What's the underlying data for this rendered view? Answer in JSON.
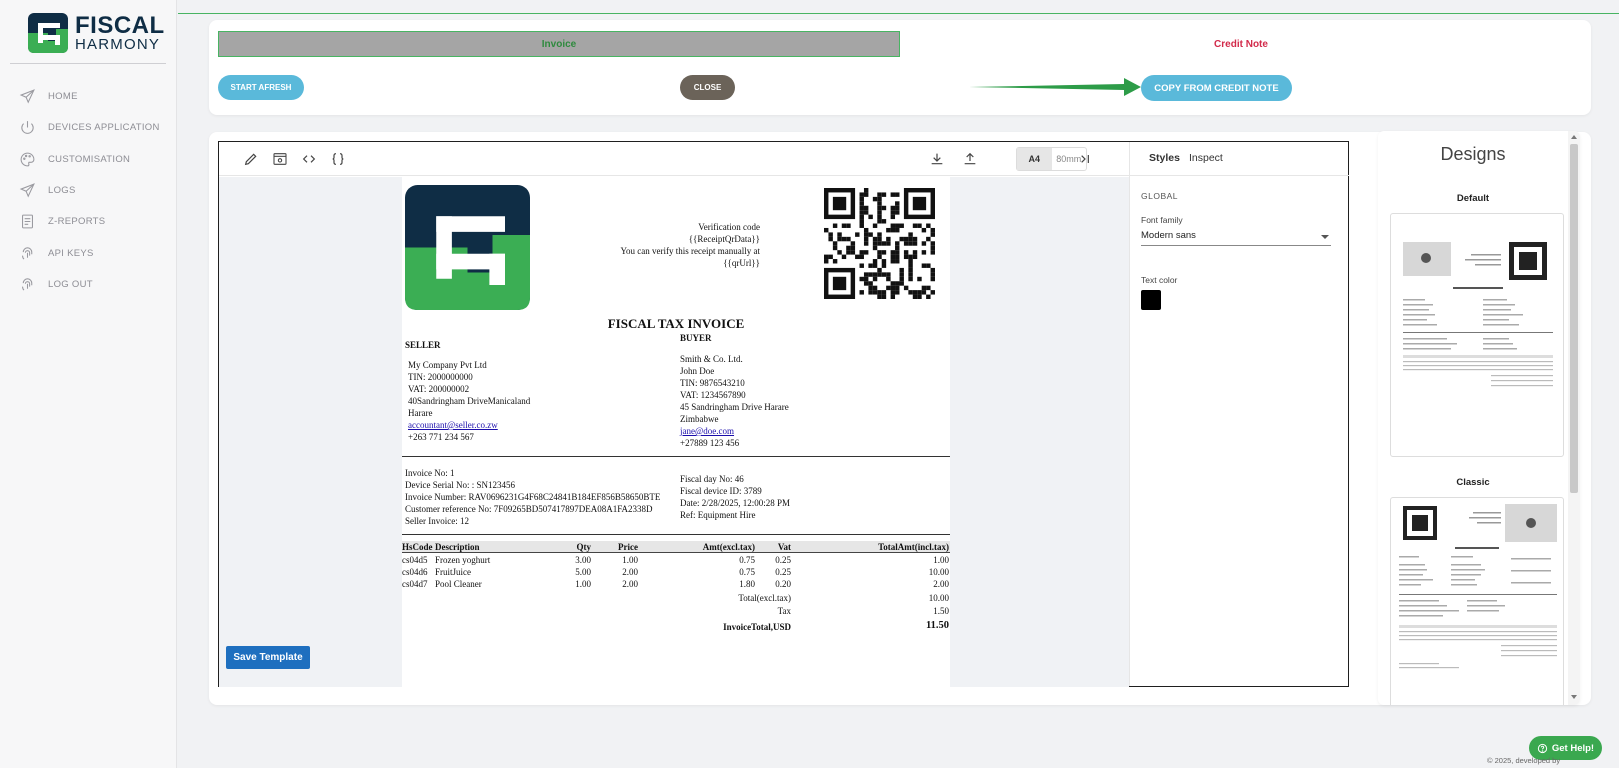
{
  "brand": {
    "line1": "FISCAL",
    "line2": "HARMONY",
    "dark": "#0f2d45",
    "green": "#3bae54"
  },
  "nav": [
    {
      "label": "HOME",
      "icon": "send-icon"
    },
    {
      "label": "DEVICES APPLICATION",
      "icon": "power-icon"
    },
    {
      "label": "CUSTOMISATION",
      "icon": "palette-icon"
    },
    {
      "label": "LOGS",
      "icon": "send-icon"
    },
    {
      "label": "Z-REPORTS",
      "icon": "document-icon"
    },
    {
      "label": "API KEYS",
      "icon": "fingerprint-icon"
    },
    {
      "label": "LOG OUT",
      "icon": "fingerprint-icon"
    }
  ],
  "tabs": {
    "invoice": "Invoice",
    "credit_note": "Credit Note"
  },
  "actions": {
    "start_afresh": "START AFRESH",
    "close": "CLOSE",
    "copy_from_credit_note": "COPY FROM CREDIT NOTE"
  },
  "toolbar": {
    "size_a4": "A4",
    "size_80": "80mm",
    "icons": [
      "pencil-icon",
      "preview-icon",
      "code-icon",
      "braces-icon",
      "download-icon",
      "upload-icon",
      "collapse-panel-icon"
    ]
  },
  "panel": {
    "tab_styles": "Styles",
    "tab_inspect": "Inspect",
    "global_label": "GLOBAL",
    "font_family_label": "Font family",
    "font_family_value": "Modern sans",
    "text_color_label": "Text color",
    "text_color_value": "#000000"
  },
  "receipt": {
    "verification": [
      "Verification code",
      "{{ReceiptQrData}}",
      "You can verify this receipt manually at",
      "{{qrUrl}}"
    ],
    "title": "FISCAL TAX INVOICE",
    "seller_heading": "SELLER",
    "seller": [
      "My Company Pvt Ltd",
      "TIN: 2000000000",
      "VAT: 200000002",
      "40Sandringham DriveManicaland",
      "Harare"
    ],
    "seller_email": "accountant@seller.co.zw",
    "seller_phone": "+263 771 234 567",
    "buyer_heading": "BUYER",
    "buyer": [
      "Smith & Co. Ltd.",
      "John Doe",
      "TIN: 9876543210",
      "VAT: 1234567890",
      "45 Sandringham Drive Harare",
      "Zimbabwe"
    ],
    "buyer_email": "jane@doe.com",
    "buyer_phone": "+27889 123 456",
    "info_left": [
      "Invoice No: 1",
      "Device Serial No: : SN123456",
      "Invoice Number: RAV0696231G4F68C24841B184EF856B58650BTE",
      "Customer reference No: 7F09265BD507417897DEA08A1FA2338D",
      "Seller Invoice: 12"
    ],
    "info_right": [
      "Fiscal day No: 46",
      "Fiscal device ID: 3789",
      "Date: 2/28/2025, 12:00:28 PM",
      "Ref: Equipment Hire"
    ],
    "columns": [
      "HsCode",
      "Description",
      "Qty",
      "Price",
      "Amt(excl.tax)",
      "Vat",
      "TotalAmt(incl.tax)"
    ],
    "rows": [
      [
        "cs04d5",
        "Frozen yoghurt",
        "3.00",
        "1.00",
        "0.75",
        "0.25",
        "1.00"
      ],
      [
        "cs04d6",
        "FruitJuice",
        "5.00",
        "2.00",
        "0.75",
        "0.25",
        "10.00"
      ],
      [
        "cs04d7",
        "Pool Cleaner",
        "1.00",
        "2.00",
        "1.80",
        "0.20",
        "2.00"
      ]
    ],
    "totals": [
      {
        "label": "Total(excl.tax)",
        "value": "10.00"
      },
      {
        "label": "Tax",
        "value": "1.50"
      },
      {
        "label": "InvoiceTotal,USD",
        "value": "11.50"
      }
    ]
  },
  "save_template": "Save Template",
  "designs": {
    "title": "Designs",
    "items": [
      "Default",
      "Classic"
    ]
  },
  "help": "Get Help!",
  "footer": "© 2025, developed by"
}
